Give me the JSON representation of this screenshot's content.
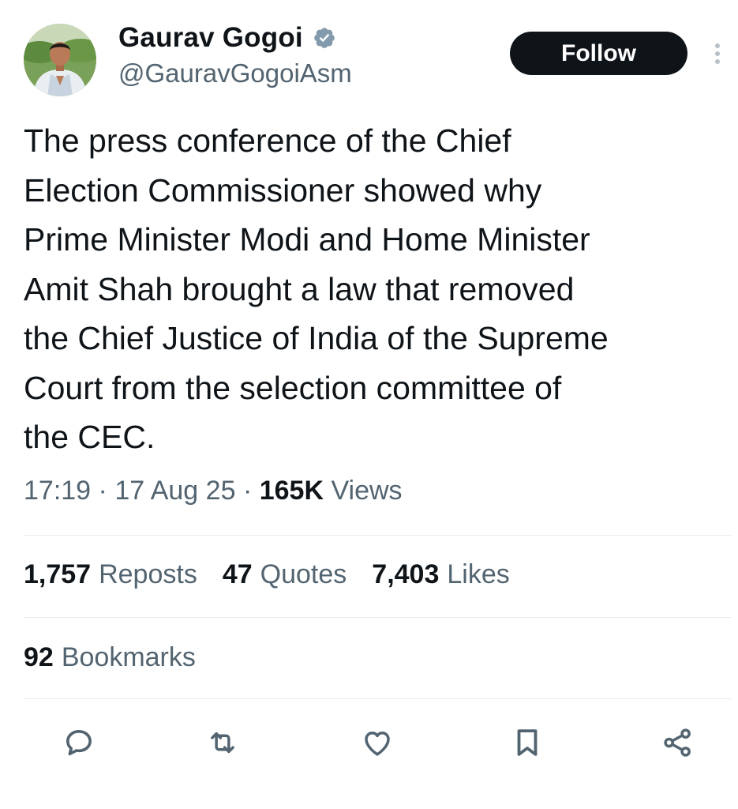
{
  "author": {
    "display_name": "Gaurav Gogoi",
    "handle": "@GauravGogoiAsm",
    "verified": true,
    "avatar_icon": "avatar-photo"
  },
  "follow_label": "Follow",
  "tweet_text": "The press conference of the Chief\nElection Commissioner showed why\nPrime Minister Modi and Home Minister\nAmit Shah brought a law that removed\nthe Chief Justice of India of the Supreme\nCourt from the selection committee of\nthe CEC.",
  "meta": {
    "time": "17:19",
    "date": "17 Aug 25",
    "views_count": "165K",
    "views_label": "Views",
    "separator": "·"
  },
  "stats": {
    "reposts_count": "1,757",
    "reposts_label": "Reposts",
    "quotes_count": "47",
    "quotes_label": "Quotes",
    "likes_count": "7,403",
    "likes_label": "Likes",
    "bookmarks_count": "92",
    "bookmarks_label": "Bookmarks"
  },
  "actions": [
    "reply-icon",
    "repost-icon",
    "like-icon",
    "bookmark-icon",
    "share-icon"
  ],
  "colors": {
    "text_primary": "#0f1419",
    "text_secondary": "#536471",
    "follow_bg": "#0f1419",
    "divider": "#e6ecf0",
    "verified_badge": "#829aab"
  }
}
